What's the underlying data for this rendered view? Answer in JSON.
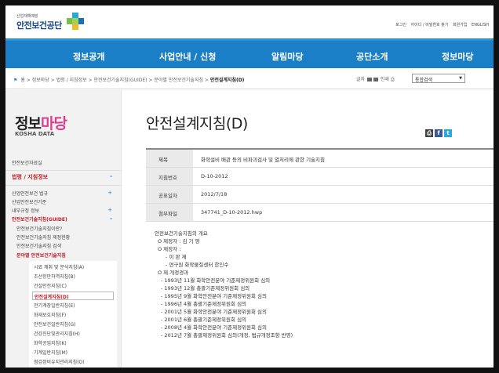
{
  "header": {
    "agency_small": "산업재해예방",
    "agency_name": "안전보건공단",
    "util_links": [
      "로그인",
      "아이디 / 비밀번호 찾기",
      "회원가입",
      "ENGLISH"
    ]
  },
  "nav": {
    "items": [
      "정보공개",
      "사업안내 / 신청",
      "알림마당",
      "공단소개",
      "정보마당"
    ]
  },
  "breadcrumb": {
    "home": "홈",
    "path": [
      "정보마당",
      "법령 / 지침정보",
      "안전보건기술지침(GUIDE)",
      "분야별 안전보건기술지침"
    ],
    "current": "안전설계지침(D)",
    "font_label": "글자",
    "print_label": "인쇄",
    "select_value": "통합검색"
  },
  "sidebar": {
    "title_1": "정보",
    "title_2": "마당",
    "subtitle": "KOSHA DATA",
    "top_item": "안전보건자료실",
    "category": "법령 / 지침정보",
    "items": [
      "산업안전보건 법규",
      "산업안전보건기준",
      "내부규정 정보",
      "안전보건기술지침(GUIDE)",
      "안전보건기술지침이란?",
      "안전보건기술지침 제정현황",
      "안전보건기술지침 검색",
      "분야별 안전보건기술지침"
    ],
    "sub_items": [
      "시료 채취 및 분석지침(A)",
      "조선항만하역지침(B)",
      "건설안전지침(C)",
      "안전설계지침(D)",
      "전기계장일반지침(E)",
      "화재보호지침(F)",
      "안전보건일반지침(G)",
      "건강진단및관리지침(H)",
      "화학공업지침(K)",
      "기계일반지침(M)",
      "점검정비유지관리지침(O)"
    ]
  },
  "content": {
    "title": "안전설계지침(D)",
    "info_rows": [
      {
        "label": "제목",
        "value": "화학설비 배관 등의 비파괴검사 및 열처리에 관한 기술지침"
      },
      {
        "label": "지침번호",
        "value": "D-10-2012"
      },
      {
        "label": "공표일자",
        "value": "2012/7/18"
      },
      {
        "label": "첨부파일",
        "value": "347741_D-10-2012.hwp"
      }
    ],
    "body_lines": [
      "안전보건기술지침의 개요",
      "O 제정자 : 김 기 영",
      "O 제정자 :",
      "- 이 판 재",
      "- 연구원 화학물질센터 한인수",
      "O 제.개정경과",
      "- 1993년 11월 화학안전분야 기준제정위원회 심의",
      "- 1993년 12월 총괄기준제정위원회 심의",
      "- 1995년 9월 화학안전분야 기준제정위원회 심의",
      "- 1996년 4월 총괄기준제정위원회 심의",
      "- 2001년 5월 화학안전분야 기준제정위원회 심의",
      "- 2001년 6월 총괄기준제정위원회 심의",
      "- 2008년 4월 화학안전분야 기준제정위원회 심의",
      "- 2012년 7월 총괄제정위원회 심의(개정, 법규개정조항 반영)"
    ]
  },
  "colors": {
    "nav_blue": "#1b7fc7",
    "accent_red": "#c0202a",
    "title_pink": "#e23a8a"
  }
}
